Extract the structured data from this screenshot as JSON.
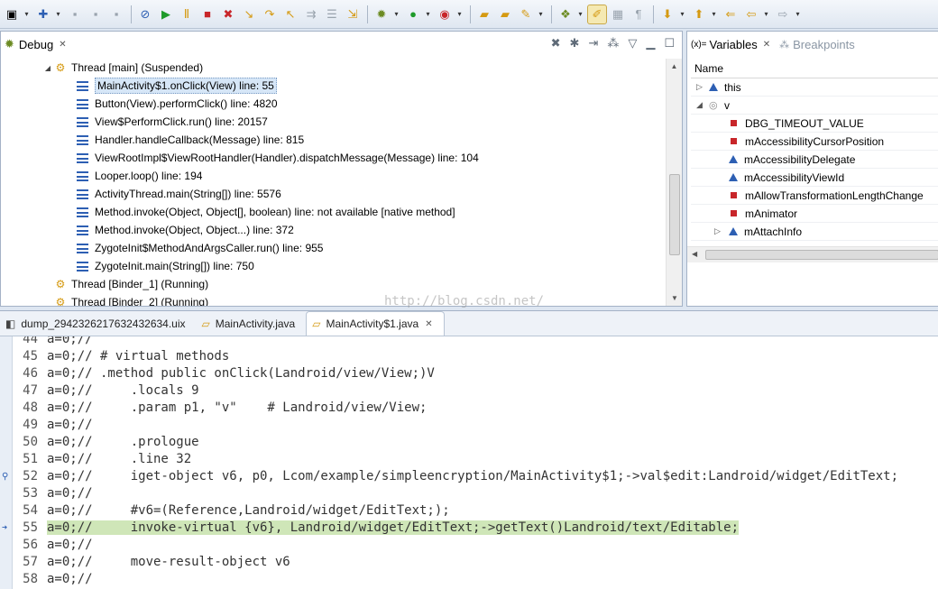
{
  "toolbar": {
    "icons": [
      "new-icon",
      "new-dd",
      "new-wizard-icon",
      "save-icon",
      "save-all-icon",
      "print-icon",
      "sep",
      "skip-breakpoints-icon",
      "resume-icon",
      "suspend-icon",
      "terminate-icon",
      "disconnect-icon",
      "step-into-icon",
      "step-over-icon",
      "step-return-icon",
      "drop-to-frame-icon",
      "use-step-filters-icon",
      "sep",
      "debug-icon",
      "run-icon",
      "run-dd",
      "external-tools-icon",
      "ext-dd",
      "sep",
      "open-type-icon",
      "open-folder-icon",
      "search-icon",
      "search-dd",
      "sep",
      "toggle-mark-icon",
      "highlight-icon",
      "block-select-icon",
      "show-whitespace-icon",
      "sep",
      "next-annotation-icon",
      "prev-annotation-icon",
      "back-icon",
      "forward-icon"
    ]
  },
  "debug": {
    "tab_label": "Debug",
    "threads": [
      {
        "label": "Thread [main] (Suspended)",
        "expanded": true,
        "frames": [
          "MainActivity$1.onClick(View) line: 55",
          "Button(View).performClick() line: 4820",
          "View$PerformClick.run() line: 20157",
          "Handler.handleCallback(Message) line: 815",
          "ViewRootImpl$ViewRootHandler(Handler).dispatchMessage(Message) line: 104",
          "Looper.loop() line: 194",
          "ActivityThread.main(String[]) line: 5576",
          "Method.invoke(Object, Object[], boolean) line: not available [native method]",
          "Method.invoke(Object, Object...) line: 372",
          "ZygoteInit$MethodAndArgsCaller.run() line: 955",
          "ZygoteInit.main(String[]) line: 750"
        ]
      },
      {
        "label": "Thread [Binder_1] (Running)"
      },
      {
        "label": "Thread [Binder_2] (Running)"
      }
    ]
  },
  "variables": {
    "tab_label": "Variables",
    "tab_prefix": "(x)=",
    "breakpoints_label": "Breakpoints",
    "column_name": "Name",
    "rows": [
      {
        "name": "this",
        "twist": "▷",
        "icon": "triangle",
        "indent": 0
      },
      {
        "name": "v",
        "twist": "◢",
        "icon": "circle",
        "indent": 0
      },
      {
        "name": "DBG_TIMEOUT_VALUE",
        "icon": "square",
        "indent": 1
      },
      {
        "name": "mAccessibilityCursorPosition",
        "icon": "square",
        "indent": 1
      },
      {
        "name": "mAccessibilityDelegate",
        "icon": "triangle",
        "indent": 1
      },
      {
        "name": "mAccessibilityViewId",
        "icon": "triangle",
        "indent": 1
      },
      {
        "name": "mAllowTransformationLengthChange",
        "icon": "square",
        "indent": 1
      },
      {
        "name": "mAnimator",
        "icon": "square",
        "indent": 1
      },
      {
        "name": "mAttachInfo",
        "twist": "▷",
        "icon": "triangle",
        "indent": 1
      }
    ]
  },
  "watermark": "http://blog.csdn.net/",
  "editor": {
    "tabs": [
      {
        "label": "dump_2942326217632432634.uix",
        "active": false,
        "closable": false
      },
      {
        "label": "MainActivity.java",
        "active": false,
        "closable": false
      },
      {
        "label": "MainActivity$1.java",
        "active": true,
        "closable": true
      }
    ],
    "lines": [
      {
        "num": "44",
        "text": "a=0;//"
      },
      {
        "num": "45",
        "text": "a=0;// # virtual methods"
      },
      {
        "num": "46",
        "text": "a=0;// .method public onClick(Landroid/view/View;)V"
      },
      {
        "num": "47",
        "text": "a=0;//     .locals 9"
      },
      {
        "num": "48",
        "text": "a=0;//     .param p1, \"v\"    # Landroid/view/View;"
      },
      {
        "num": "49",
        "text": "a=0;//"
      },
      {
        "num": "50",
        "text": "a=0;//     .prologue"
      },
      {
        "num": "51",
        "text": "a=0;//     .line 32"
      },
      {
        "num": "52",
        "text": "a=0;//     iget-object v6, p0, Lcom/example/simpleencryption/MainActivity$1;->val$edit:Landroid/widget/EditText;"
      },
      {
        "num": "53",
        "text": "a=0;//"
      },
      {
        "num": "54",
        "text": "a=0;//     #v6=(Reference,Landroid/widget/EditText;);"
      },
      {
        "num": "55",
        "text": "a=0;//     invoke-virtual {v6}, Landroid/widget/EditText;->getText()Landroid/text/Editable;",
        "highlight": true
      },
      {
        "num": "56",
        "text": "a=0;//"
      },
      {
        "num": "57",
        "text": "a=0;//     move-result-object v6"
      },
      {
        "num": "58",
        "text": "a=0;//"
      }
    ]
  }
}
